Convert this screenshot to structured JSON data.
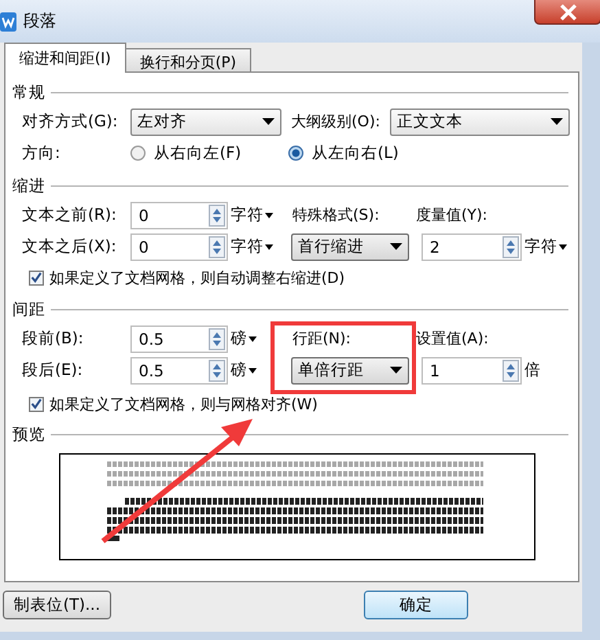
{
  "window": {
    "title": "段落"
  },
  "tabs": [
    {
      "label": "缩进和间距(I)",
      "selected": true
    },
    {
      "label": "换行和分页(P)",
      "selected": false
    }
  ],
  "general": {
    "title": "常规",
    "alignment": {
      "label": "对齐方式(G):",
      "value": "左对齐"
    },
    "outline_level": {
      "label": "大纲级别(O):",
      "value": "正文文本"
    },
    "direction": {
      "label": "方向:",
      "options": [
        {
          "label": "从右向左(F)",
          "selected": false
        },
        {
          "label": "从左向右(L)",
          "selected": true
        }
      ]
    }
  },
  "indent": {
    "title": "缩进",
    "before": {
      "label": "文本之前(R):",
      "value": "0",
      "unit": "字符",
      "menu": true
    },
    "after": {
      "label": "文本之后(X):",
      "value": "0",
      "unit": "字符",
      "menu": true
    },
    "special": {
      "label": "特殊格式(S):",
      "value": "首行缩进"
    },
    "by": {
      "label": "度量值(Y):",
      "value": "2",
      "unit": "字符",
      "menu": true
    },
    "grid_check": {
      "label": "如果定义了文档网格，则自动调整右缩进(D)",
      "checked": true
    }
  },
  "spacing": {
    "title": "间距",
    "before": {
      "label": "段前(B):",
      "value": "0.5",
      "unit": "磅",
      "menu": true
    },
    "after": {
      "label": "段后(E):",
      "value": "0.5",
      "unit": "磅",
      "menu": true
    },
    "line_spacing": {
      "label": "行距(N):",
      "value": "单倍行距"
    },
    "at": {
      "label": "设置值(A):",
      "value": "1",
      "unit": "倍",
      "menu": false
    },
    "grid_check": {
      "label": "如果定义了文档网格，则与网格对齐(W)",
      "checked": true
    }
  },
  "preview": {
    "title": "预览"
  },
  "buttons": [
    {
      "label": "制表位(T)..."
    },
    {
      "label": "确定"
    }
  ]
}
